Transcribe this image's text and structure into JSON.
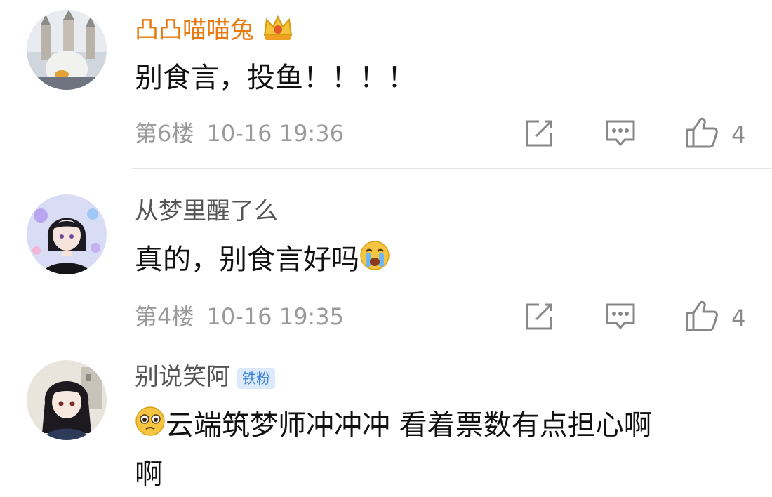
{
  "comments": [
    {
      "username": "凸凸喵喵兔",
      "username_color": "#e87a10",
      "crown_icon": "crown-icon",
      "text": "别食言，投鱼！！！！",
      "floor": "第6楼",
      "time": "10-16 19:36",
      "likes": "4"
    },
    {
      "username": "从梦里醒了么",
      "username_color": "#555555",
      "text": "真的，别食言好吗",
      "trailing_emoji": "crying-face-emoji",
      "floor": "第4楼",
      "time": "10-16 19:35",
      "likes": "4"
    },
    {
      "username": "别说笑阿",
      "username_color": "#555555",
      "badge": "铁粉",
      "leading_emoji": "pleading-face-emoji",
      "text_line1": "云端筑梦师冲冲冲 看着票数有点担心啊",
      "text_line2": "啊"
    }
  ],
  "icons": {
    "edit": "edit-icon",
    "reply": "comment-icon",
    "like": "thumbs-up-icon"
  }
}
